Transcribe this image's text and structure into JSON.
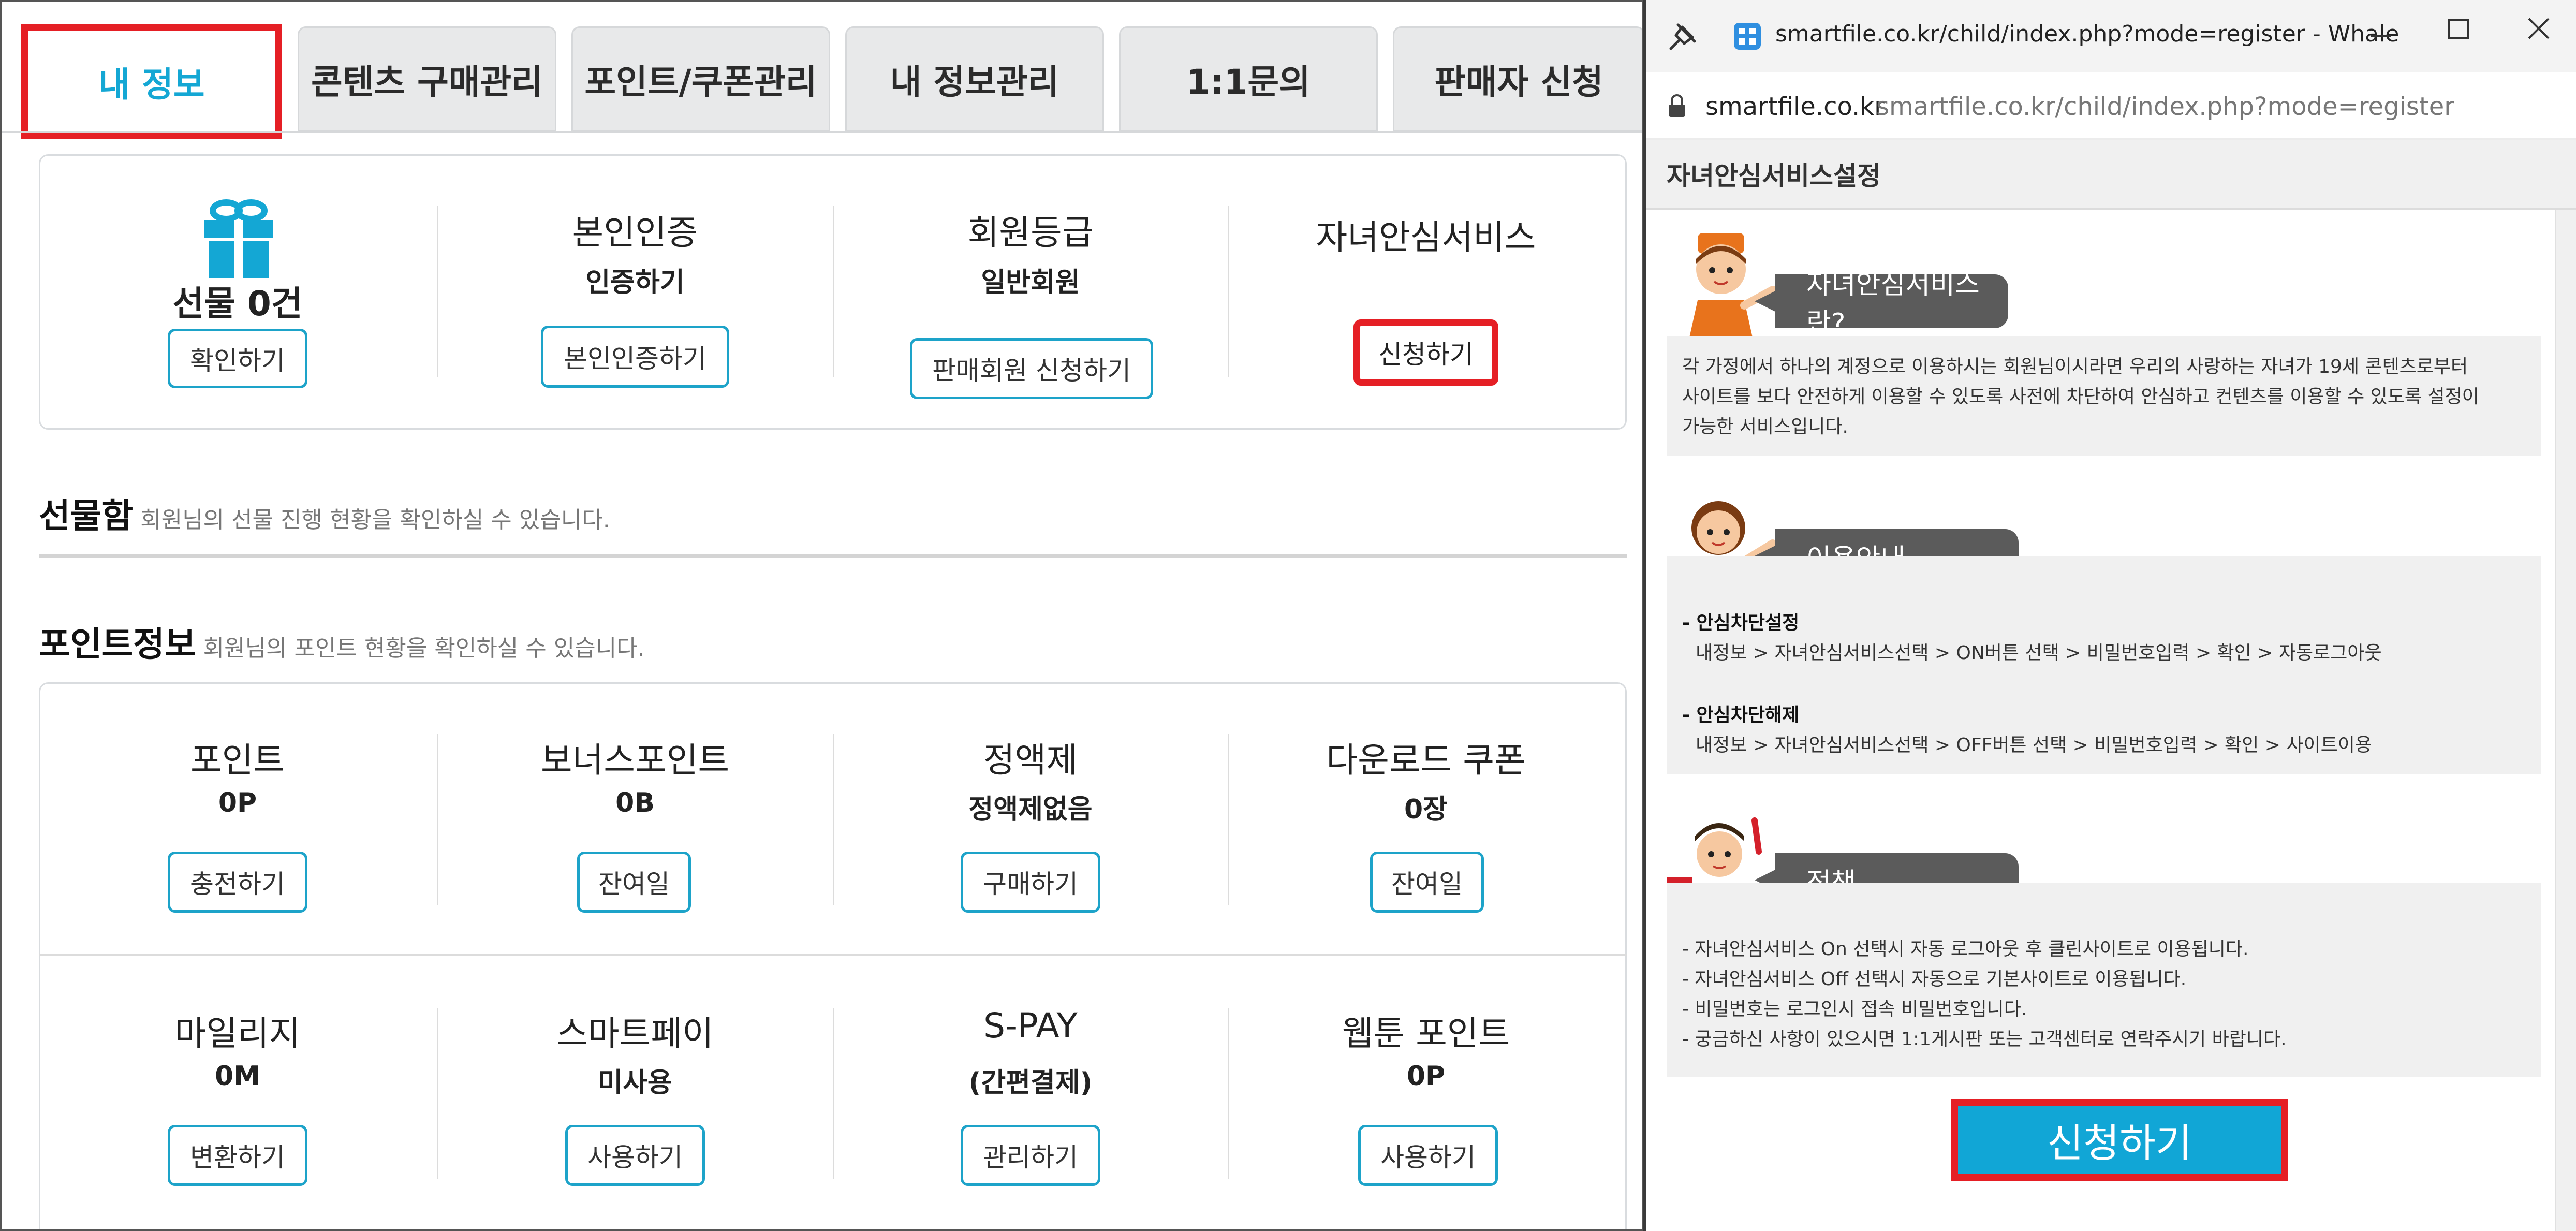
{
  "tabs": [
    {
      "label": "내 정보"
    },
    {
      "label": "콘텐츠 구매관리"
    },
    {
      "label": "포인트/쿠폰관리"
    },
    {
      "label": "내 정보관리"
    },
    {
      "label": "1:1문의"
    },
    {
      "label": "판매자 신청"
    }
  ],
  "summary": {
    "gift": {
      "title": "선물 0건",
      "button": "확인하기"
    },
    "verify": {
      "title": "본인인증",
      "value": "인증하기",
      "button": "본인인증하기"
    },
    "grade": {
      "title": "회원등급",
      "value": "일반회원",
      "button": "판매회원 신청하기"
    },
    "child": {
      "title": "자녀안심서비스",
      "button": "신청하기"
    }
  },
  "giftbox": {
    "title": "선물함",
    "desc": "회원님의 선물 진행 현황을 확인하실 수 있습니다."
  },
  "pointinfo": {
    "title": "포인트정보",
    "desc": "회원님의 포인트 현황을 확인하실 수 있습니다."
  },
  "points_row1": [
    {
      "title": "포인트",
      "value": "0P",
      "button": "충전하기"
    },
    {
      "title": "보너스포인트",
      "value": "0B",
      "button": "잔여일"
    },
    {
      "title": "정액제",
      "value": "정액제없음",
      "button": "구매하기"
    },
    {
      "title": "다운로드 쿠폰",
      "value": "0장",
      "button": "잔여일"
    }
  ],
  "points_row2": [
    {
      "title": "마일리지",
      "value": "0M",
      "button": "변환하기"
    },
    {
      "title": "스마트페이",
      "value": "미사용",
      "button": "사용하기"
    },
    {
      "title": "S-PAY",
      "value": "(간편결제)",
      "button": "관리하기"
    },
    {
      "title": "웹툰 포인트",
      "value": "0P",
      "button": "사용하기"
    }
  ],
  "popup": {
    "window_title": "smartfile.co.kr/child/index.php?mode=register - Whale",
    "domain": "smartfile.co.kr",
    "url": "smartfile.co.kr/child/index.php?mode=register",
    "header": "자녀안심서비스설정",
    "sec1": {
      "title": "자녀안심서비스란?",
      "lines": [
        "각 가정에서 하나의 계정으로 이용하시는 회원님이시라면 우리의 사랑하는 자녀가 19세 콘텐츠로부터",
        "사이트를 보다 안전하게 이용할 수 있도록 사전에 차단하여 안심하고 컨텐츠를 이용할 수 있도록 설정이",
        "가능한 서비스입니다."
      ]
    },
    "sec2": {
      "title": "이용안내",
      "h1": "- 안심차단설정",
      "p1": "내정보 > 자녀안심서비스선택 > ON버튼 선택 > 비밀번호입력 > 확인 > 자동로그아웃",
      "h2": "- 안심차단해제",
      "p2": "내정보 > 자녀안심서비스선택 > OFF버튼 선택 > 비밀번호입력 > 확인 > 사이트이용"
    },
    "sec3": {
      "title": "정책",
      "lines": [
        "- 자녀안심서비스 On 선택시 자동 로그아웃 후 클린사이트로 이용됩니다.",
        "- 자녀안심서비스 Off 선택시 자동으로 기본사이트로 이용됩니다.",
        "- 비밀번호는 로그인시 접속 비밀번호입니다.",
        "- 궁금하신 사항이 있으시면 1:1게시판 또는 고객센터로 연락주시기 바랍니다."
      ]
    },
    "apply_button": "신청하기"
  },
  "colors": {
    "accent": "#14a7d4",
    "highlight_red": "#e51f25",
    "bubble_gray": "#5b5b5b"
  }
}
